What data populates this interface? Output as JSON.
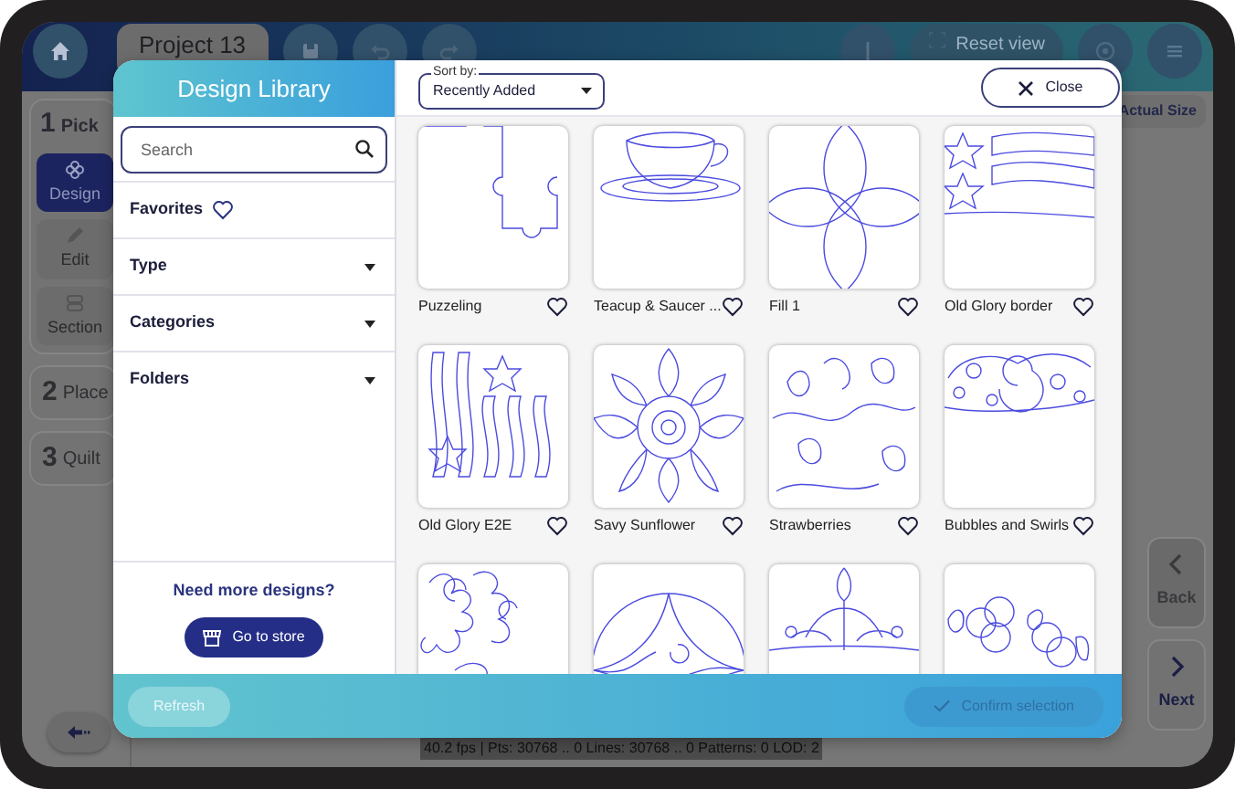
{
  "app": {
    "project_tab": "Project 13",
    "reset_button": "Reset view",
    "actual_size_button": "Actual Size",
    "steps": [
      {
        "number": "1",
        "label": "Pick",
        "substeps": [
          {
            "label": "Design",
            "selected": true
          },
          {
            "label": "Edit",
            "selected": false
          },
          {
            "label": "Section",
            "selected": false
          }
        ]
      },
      {
        "number": "2",
        "label": "Place"
      },
      {
        "number": "3",
        "label": "Quilt"
      }
    ],
    "nav_buttons": [
      {
        "label": "Back",
        "disabled": true
      },
      {
        "label": "Next",
        "disabled": false
      }
    ],
    "status_bar": "40.2 fps | Pts: 30768 .. 0 Lines: 30768 .. 0 Patterns: 0 LOD: 2"
  },
  "dialog": {
    "title": "Design Library",
    "search": {
      "placeholder": "Search"
    },
    "filters": [
      {
        "kind": "favorites",
        "label": "Favorites"
      },
      {
        "kind": "dropdown",
        "label": "Type",
        "expanded": false
      },
      {
        "kind": "dropdown",
        "label": "Categories",
        "expanded": false
      },
      {
        "kind": "dropdown",
        "label": "Folders",
        "expanded": false
      }
    ],
    "store_prompt": "Need more designs?",
    "store_button": "Go to store",
    "sort": {
      "label": "Sort by:",
      "value": "Recently Added"
    },
    "close_button": "Close",
    "designs": [
      {
        "name": "Puzzeling",
        "favorite": false
      },
      {
        "name": "Teacup & Saucer ...",
        "favorite": false
      },
      {
        "name": "Fill 1",
        "favorite": false
      },
      {
        "name": "Old Glory border",
        "favorite": false
      },
      {
        "name": "Old Glory E2E",
        "favorite": false
      },
      {
        "name": "Savy Sunflower",
        "favorite": false
      },
      {
        "name": "Strawberries",
        "favorite": false
      },
      {
        "name": "Bubbles and Swirls",
        "favorite": false
      },
      {
        "kind": "picture"
      },
      {
        "kind": "picture"
      },
      {
        "kind": "picture"
      },
      {
        "kind": "picture"
      }
    ],
    "refresh_button": "Refresh",
    "confirm_button": {
      "label": "Confirm selection",
      "disabled": true
    }
  }
}
